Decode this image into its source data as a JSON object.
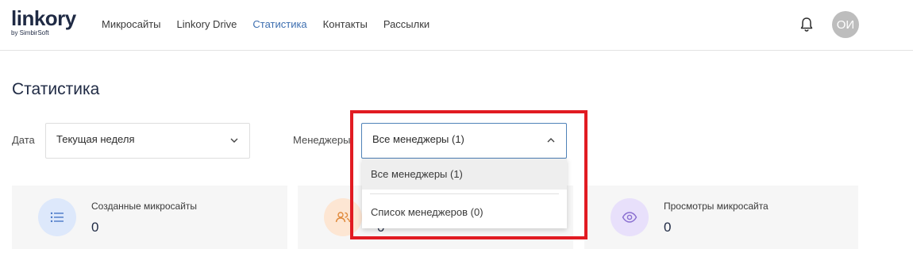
{
  "header": {
    "logo_main": "linkory",
    "logo_sub": "by SimbirSoft",
    "nav": [
      {
        "label": "Микросайты",
        "active": false
      },
      {
        "label": "Linkory Drive",
        "active": false
      },
      {
        "label": "Статистика",
        "active": true
      },
      {
        "label": "Контакты",
        "active": false
      },
      {
        "label": "Рассылки",
        "active": false
      }
    ],
    "avatar_initials": "ОИ"
  },
  "page": {
    "title": "Статистика"
  },
  "filters": {
    "date_label": "Дата",
    "date_value": "Текущая неделя",
    "managers_label": "Менеджеры",
    "managers_value": "Все менеджеры (1)",
    "managers_options": [
      "Все менеджеры (1)",
      "Список менеджеров (0)"
    ]
  },
  "cards": [
    {
      "label": "Созданные микросайты",
      "value": "0",
      "icon": "list-icon",
      "color": "#dde8fb"
    },
    {
      "label": "",
      "value": "0",
      "icon": "users-icon",
      "color": "#fde6d3"
    },
    {
      "label": "Просмотры микросайта",
      "value": "0",
      "icon": "eye-icon",
      "color": "#e8e0fb"
    }
  ],
  "colors": {
    "accent": "#3e6fb0",
    "highlight": "#e11b22"
  }
}
